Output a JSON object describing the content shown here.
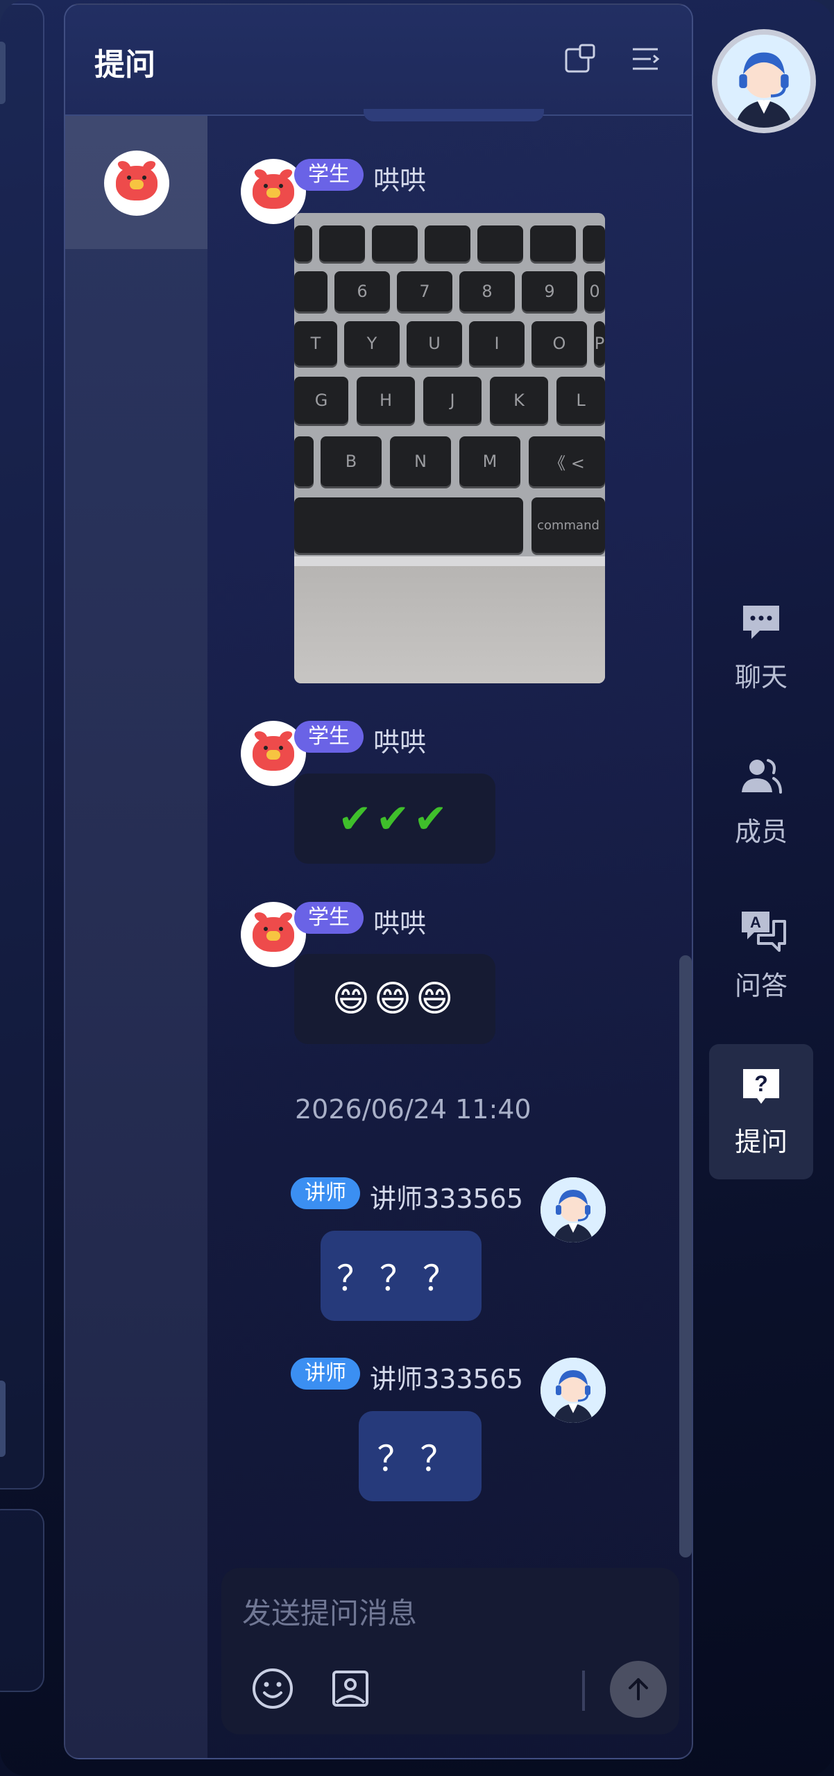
{
  "panel": {
    "title": "提问"
  },
  "messages": [
    {
      "role_badge": "学生",
      "name": "哄哄",
      "content_type": "image"
    },
    {
      "role_badge": "学生",
      "name": "哄哄",
      "content": "✔✔✔"
    },
    {
      "role_badge": "学生",
      "name": "哄哄",
      "content": "😄😄😄"
    },
    {
      "role_badge": "讲师",
      "name": "讲师333565",
      "content": "？？？"
    },
    {
      "role_badge": "讲师",
      "name": "讲师333565",
      "content": "？？"
    }
  ],
  "timestamp": "2026/06/24 11:40",
  "keyboard_photo": {
    "row1": [
      "",
      "",
      "",
      "",
      "",
      ""
    ],
    "row2": [
      "6",
      "7",
      "8",
      "9",
      "0"
    ],
    "row3": [
      "T",
      "Y",
      "U",
      "I",
      "O",
      "P"
    ],
    "row4": [
      "G",
      "H",
      "J",
      "K",
      "L"
    ],
    "row5": [
      "B",
      "N",
      "M",
      "《 <"
    ],
    "command": "command"
  },
  "input": {
    "placeholder": "发送提问消息"
  },
  "rail": {
    "items": [
      {
        "label": "聊天",
        "icon": "chat-bubble-icon"
      },
      {
        "label": "成员",
        "icon": "members-icon"
      },
      {
        "label": "问答",
        "icon": "qa-icon"
      },
      {
        "label": "提问",
        "icon": "question-icon",
        "active": true
      }
    ]
  },
  "colors": {
    "student_badge": "#6a63e6",
    "teacher_badge": "#3b8ff2",
    "teacher_bubble": "#263a7b",
    "student_bubble": "#161b33"
  }
}
